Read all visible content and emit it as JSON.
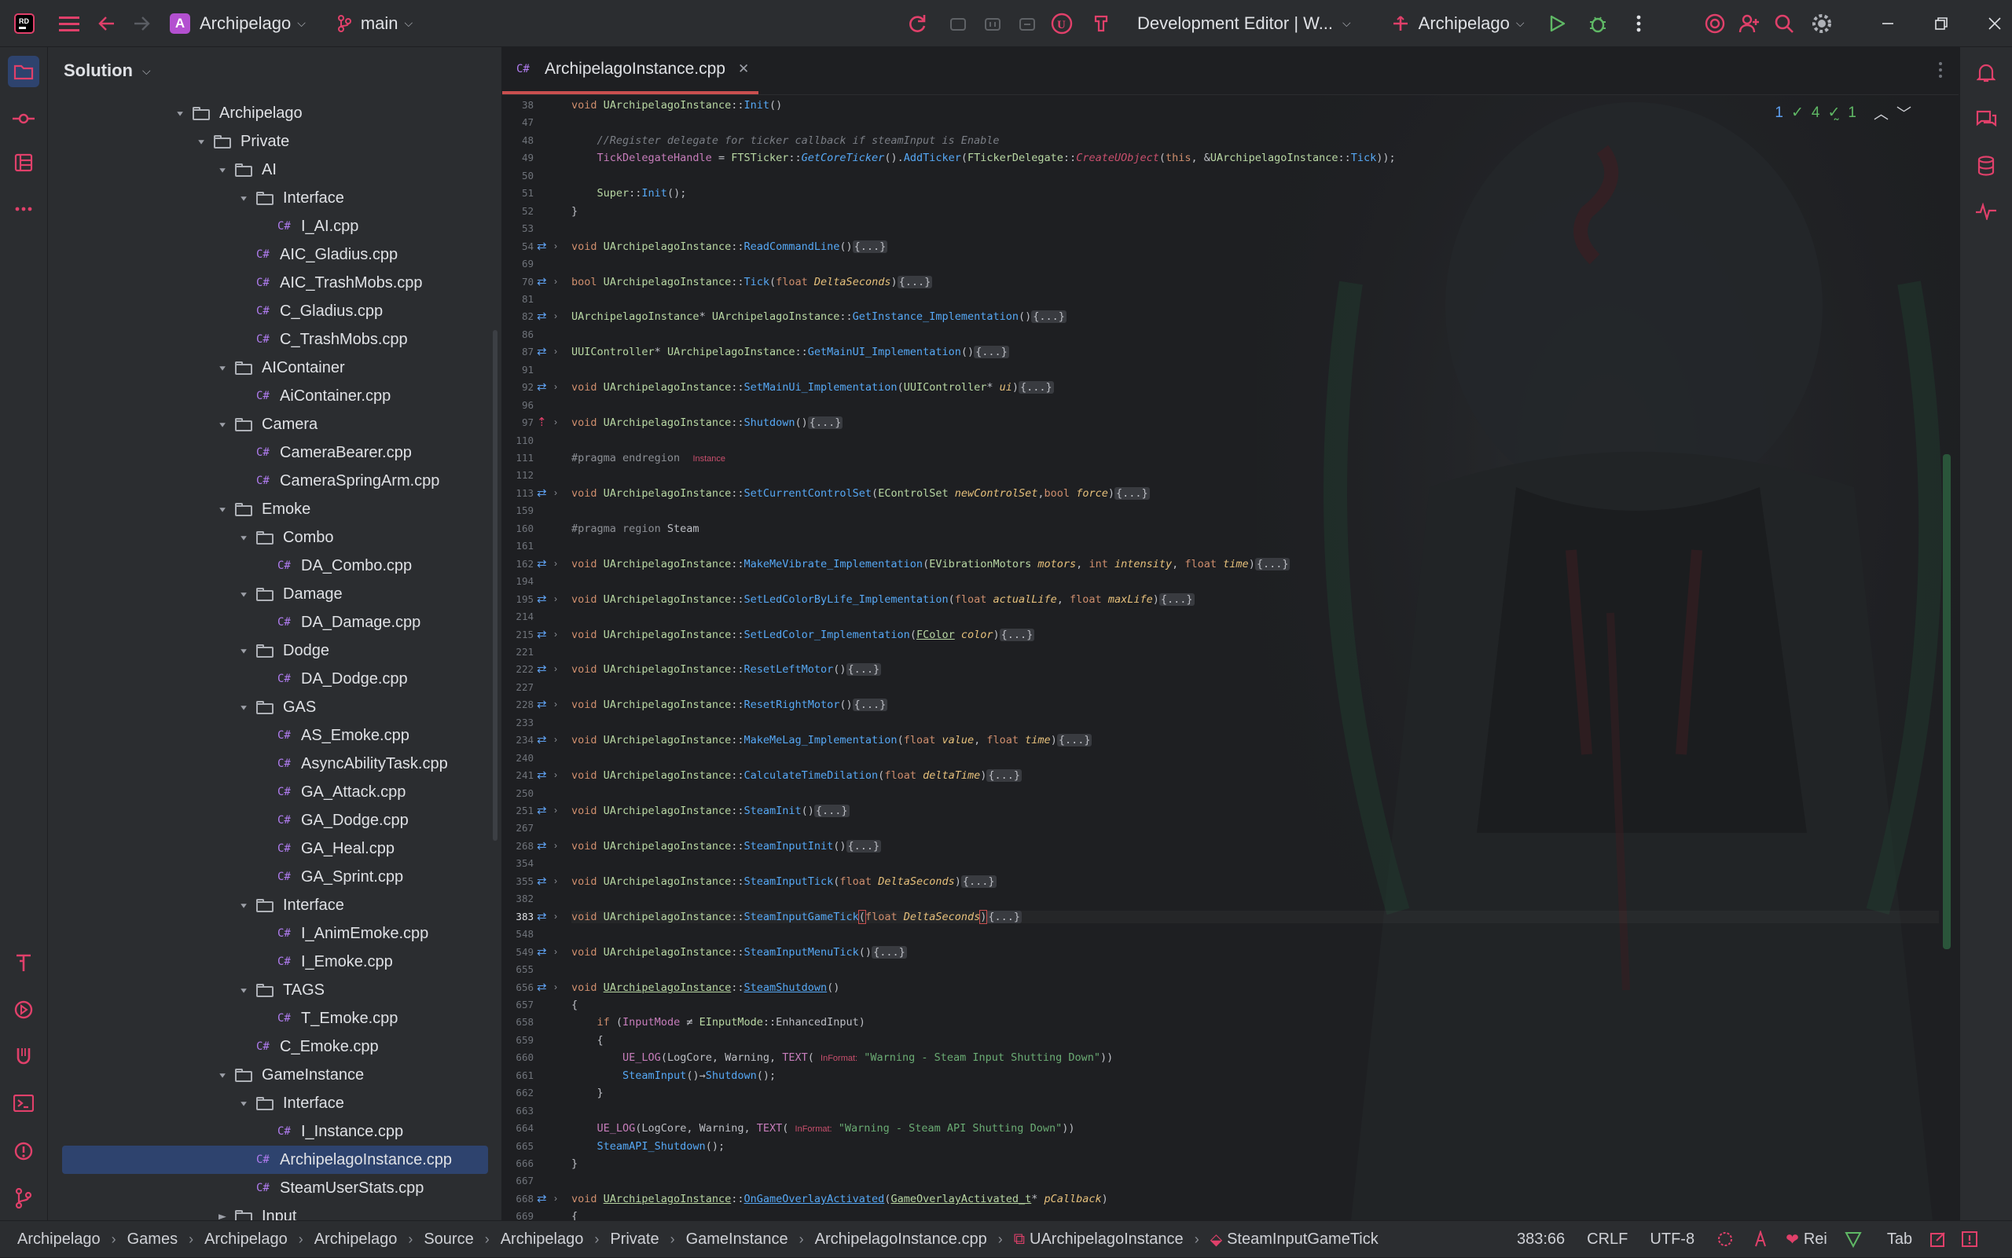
{
  "titlebar": {
    "project_initial": "A",
    "project_name": "Archipelago",
    "branch": "main",
    "config": "Development Editor | W...",
    "run_target": "Archipelago"
  },
  "panel": {
    "title": "Solution"
  },
  "tree": [
    {
      "label": "Archipelago",
      "type": "folder",
      "depth": 1,
      "expanded": true
    },
    {
      "label": "Private",
      "type": "folder",
      "depth": 2,
      "expanded": true
    },
    {
      "label": "AI",
      "type": "folder",
      "depth": 3,
      "expanded": true
    },
    {
      "label": "Interface",
      "type": "folder",
      "depth": 4,
      "expanded": true
    },
    {
      "label": "I_AI.cpp",
      "type": "file",
      "depth": 5
    },
    {
      "label": "AIC_Gladius.cpp",
      "type": "file",
      "depth": 4
    },
    {
      "label": "AIC_TrashMobs.cpp",
      "type": "file",
      "depth": 4
    },
    {
      "label": "C_Gladius.cpp",
      "type": "file",
      "depth": 4
    },
    {
      "label": "C_TrashMobs.cpp",
      "type": "file",
      "depth": 4
    },
    {
      "label": "AIContainer",
      "type": "folder",
      "depth": 3,
      "expanded": true
    },
    {
      "label": "AiContainer.cpp",
      "type": "file",
      "depth": 4
    },
    {
      "label": "Camera",
      "type": "folder",
      "depth": 3,
      "expanded": true
    },
    {
      "label": "CameraBearer.cpp",
      "type": "file",
      "depth": 4
    },
    {
      "label": "CameraSpringArm.cpp",
      "type": "file",
      "depth": 4
    },
    {
      "label": "Emoke",
      "type": "folder",
      "depth": 3,
      "expanded": true
    },
    {
      "label": "Combo",
      "type": "folder",
      "depth": 4,
      "expanded": true
    },
    {
      "label": "DA_Combo.cpp",
      "type": "file",
      "depth": 5
    },
    {
      "label": "Damage",
      "type": "folder",
      "depth": 4,
      "expanded": true
    },
    {
      "label": "DA_Damage.cpp",
      "type": "file",
      "depth": 5
    },
    {
      "label": "Dodge",
      "type": "folder",
      "depth": 4,
      "expanded": true
    },
    {
      "label": "DA_Dodge.cpp",
      "type": "file",
      "depth": 5
    },
    {
      "label": "GAS",
      "type": "folder",
      "depth": 4,
      "expanded": true
    },
    {
      "label": "AS_Emoke.cpp",
      "type": "file",
      "depth": 5
    },
    {
      "label": "AsyncAbilityTask.cpp",
      "type": "file",
      "depth": 5
    },
    {
      "label": "GA_Attack.cpp",
      "type": "file",
      "depth": 5
    },
    {
      "label": "GA_Dodge.cpp",
      "type": "file",
      "depth": 5
    },
    {
      "label": "GA_Heal.cpp",
      "type": "file",
      "depth": 5
    },
    {
      "label": "GA_Sprint.cpp",
      "type": "file",
      "depth": 5
    },
    {
      "label": "Interface",
      "type": "folder",
      "depth": 4,
      "expanded": true
    },
    {
      "label": "I_AnimEmoke.cpp",
      "type": "file",
      "depth": 5
    },
    {
      "label": "I_Emoke.cpp",
      "type": "file",
      "depth": 5
    },
    {
      "label": "TAGS",
      "type": "folder",
      "depth": 4,
      "expanded": true
    },
    {
      "label": "T_Emoke.cpp",
      "type": "file",
      "depth": 5
    },
    {
      "label": "C_Emoke.cpp",
      "type": "file",
      "depth": 4
    },
    {
      "label": "GameInstance",
      "type": "folder",
      "depth": 3,
      "expanded": true
    },
    {
      "label": "Interface",
      "type": "folder",
      "depth": 4,
      "expanded": true
    },
    {
      "label": "I_Instance.cpp",
      "type": "file",
      "depth": 5
    },
    {
      "label": "ArchipelagoInstance.cpp",
      "type": "file",
      "depth": 4,
      "selected": true
    },
    {
      "label": "SteamUserStats.cpp",
      "type": "file",
      "depth": 4
    },
    {
      "label": "Input",
      "type": "folder",
      "depth": 3,
      "expanded": false
    }
  ],
  "editor": {
    "tab_label": "ArchipelagoInstance.cpp",
    "inspections": {
      "info": "1",
      "ok": "4",
      "typo": "1"
    },
    "lines": [
      {
        "n": "38",
        "icon": "",
        "html": "<span class='k'>void</span> <span class='cls'>UArchipelagoInstance</span>::<span class='fn'>Init</span>()"
      },
      {
        "n": "47",
        "icon": "",
        "html": ""
      },
      {
        "n": "48",
        "icon": "",
        "html": "    <span class='cm'>//Register delegate for ticker callback if steamInput is Enable</span>"
      },
      {
        "n": "49",
        "icon": "",
        "html": "    <span class='m'>TickDelegateHandle</span> = <span class='cls'>FTSTicker</span>::<span class='fn' style='font-style:italic'>GetCoreTicker</span>().<span class='fn'>AddTicker</span>(<span class='cls'>FTickerDelegate</span>::<span class='fn' style='color:#c94f6d;font-style:italic'>CreateUObject</span>(<span class='k'>this</span>, &amp;<span class='cls'>UArchipelagoInstance</span>::<span class='fn'>Tick</span>));"
      },
      {
        "n": "50",
        "icon": "",
        "html": ""
      },
      {
        "n": "51",
        "icon": "",
        "html": "    <span class='cls'>Super</span>::<span class='fn'>Init</span>();"
      },
      {
        "n": "52",
        "icon": "",
        "html": "}"
      },
      {
        "n": "53",
        "icon": "",
        "html": ""
      },
      {
        "n": "54",
        "icon": "swap",
        "html": "<span class='k'>void</span> <span class='cls'>UArchipelagoInstance</span>::<span class='fn'>ReadCommandLine</span>()<span class='fold'>{...}</span>"
      },
      {
        "n": "69",
        "icon": "",
        "html": ""
      },
      {
        "n": "70",
        "icon": "swap",
        "html": "<span class='k'>bool</span> <span class='cls'>UArchipelagoInstance</span>::<span class='fn'>Tick</span>(<span class='k'>float</span> <span class='p'>DeltaSeconds</span>)<span class='fold'>{...}</span>"
      },
      {
        "n": "81",
        "icon": "",
        "html": ""
      },
      {
        "n": "82",
        "icon": "swap",
        "html": "<span class='cls'>UArchipelagoInstance</span>* <span class='cls'>UArchipelagoInstance</span>::<span class='fn'>GetInstance_Implementation</span>()<span class='fold'>{...}</span>"
      },
      {
        "n": "86",
        "icon": "",
        "html": ""
      },
      {
        "n": "87",
        "icon": "swap",
        "html": "<span class='cls'>UUIController</span>* <span class='cls'>UArchipelagoInstance</span>::<span class='fn'>GetMainUI_Implementation</span>()<span class='fold'>{...}</span>"
      },
      {
        "n": "91",
        "icon": "",
        "html": ""
      },
      {
        "n": "92",
        "icon": "swap",
        "html": "<span class='k'>void</span> <span class='cls'>UArchipelagoInstance</span>::<span class='fn'>SetMainUi_Implementation</span>(<span class='cls'>UUIController</span>* <span class='p'>ui</span>)<span class='fold'>{...}</span>"
      },
      {
        "n": "96",
        "icon": "",
        "html": ""
      },
      {
        "n": "97",
        "icon": "up",
        "html": "<span class='k'>void</span> <span class='cls'>UArchipelagoInstance</span>::<span class='fn'>Shutdown</span>()<span class='fold'>{...}</span>"
      },
      {
        "n": "110",
        "icon": "",
        "html": ""
      },
      {
        "n": "111",
        "icon": "",
        "html": "<span class='k' style='color:#8c8f95'>#pragma endregion</span>  <span class='hint'>Instance</span>"
      },
      {
        "n": "112",
        "icon": "",
        "html": ""
      },
      {
        "n": "113",
        "icon": "swap",
        "html": "<span class='k'>void</span> <span class='cls'>UArchipelagoInstance</span>::<span class='fn'>SetCurrentControlSet</span>(<span class='cls'>EControlSet</span> <span class='p'>newControlSet</span>,<span class='k'>bool</span> <span class='p'>force</span>)<span class='fold'>{...}</span>"
      },
      {
        "n": "159",
        "icon": "",
        "html": ""
      },
      {
        "n": "160",
        "icon": "",
        "html": "<span class='k' style='color:#8c8f95'>#pragma region</span> Steam"
      },
      {
        "n": "161",
        "icon": "",
        "html": ""
      },
      {
        "n": "162",
        "icon": "swap",
        "html": "<span class='k'>void</span> <span class='cls'>UArchipelagoInstance</span>::<span class='fn'>MakeMeVibrate_Implementation</span>(<span class='cls'>EVibrationMotors</span> <span class='p'>motors</span>, <span class='k'>int</span> <span class='p'>intensity</span>, <span class='k'>float</span> <span class='p'>time</span>)<span class='fold'>{...}</span>"
      },
      {
        "n": "194",
        "icon": "",
        "html": ""
      },
      {
        "n": "195",
        "icon": "swap",
        "html": "<span class='k'>void</span> <span class='cls'>UArchipelagoInstance</span>::<span class='fn'>SetLedColorByLife_Implementation</span>(<span class='k'>float</span> <span class='p'>actualLife</span>, <span class='k'>float</span> <span class='p'>maxLife</span>)<span class='fold'>{...}</span>"
      },
      {
        "n": "214",
        "icon": "",
        "html": ""
      },
      {
        "n": "215",
        "icon": "swap",
        "html": "<span class='k'>void</span> <span class='cls'>UArchipelagoInstance</span>::<span class='fn'>SetLedColor_Implementation</span>(<span class='cls' style='text-decoration:underline'>FColor</span> <span class='p'>color</span>)<span class='fold'>{...}</span>"
      },
      {
        "n": "221",
        "icon": "",
        "html": ""
      },
      {
        "n": "222",
        "icon": "swap",
        "html": "<span class='k'>void</span> <span class='cls'>UArchipelagoInstance</span>::<span class='fn'>ResetLeftMotor</span>()<span class='fold'>{...}</span>"
      },
      {
        "n": "227",
        "icon": "",
        "html": ""
      },
      {
        "n": "228",
        "icon": "swap",
        "html": "<span class='k'>void</span> <span class='cls'>UArchipelagoInstance</span>::<span class='fn'>ResetRightMotor</span>()<span class='fold'>{...}</span>"
      },
      {
        "n": "233",
        "icon": "",
        "html": ""
      },
      {
        "n": "234",
        "icon": "swap",
        "html": "<span class='k'>void</span> <span class='cls'>UArchipelagoInstance</span>::<span class='fn'>MakeMeLag_Implementation</span>(<span class='k'>float</span> <span class='p'>value</span>, <span class='k'>float</span> <span class='p'>time</span>)<span class='fold'>{...}</span>"
      },
      {
        "n": "240",
        "icon": "",
        "html": ""
      },
      {
        "n": "241",
        "icon": "swap",
        "html": "<span class='k'>void</span> <span class='cls'>UArchipelagoInstance</span>::<span class='fn'>CalculateTimeDilation</span>(<span class='k'>float</span> <span class='p'>deltaTime</span>)<span class='fold'>{...}</span>"
      },
      {
        "n": "250",
        "icon": "",
        "html": ""
      },
      {
        "n": "251",
        "icon": "swap",
        "html": "<span class='k'>void</span> <span class='cls'>UArchipelagoInstance</span>::<span class='fn'>SteamInit</span>()<span class='fold'>{...}</span>"
      },
      {
        "n": "267",
        "icon": "",
        "html": ""
      },
      {
        "n": "268",
        "icon": "swap",
        "html": "<span class='k'>void</span> <span class='cls'>UArchipelagoInstance</span>::<span class='fn'>SteamInputInit</span>()<span class='fold'>{...}</span>"
      },
      {
        "n": "354",
        "icon": "",
        "html": ""
      },
      {
        "n": "355",
        "icon": "swap",
        "html": "<span class='k'>void</span> <span class='cls'>UArchipelagoInstance</span>::<span class='fn'>SteamInputTick</span>(<span class='k'>float</span> <span class='p'>DeltaSeconds</span>)<span class='fold'>{...}</span>"
      },
      {
        "n": "382",
        "icon": "",
        "html": ""
      },
      {
        "n": "383",
        "icon": "swap",
        "cur": true,
        "html": "<span class='k'>void</span> <span class='cls'>UArchipelagoInstance</span>::<span class='fn'>SteamInputGameTick</span><span style='outline:1px solid #c94f4f'>(</span><span class='k'>float</span> <span class='p'>DeltaSeconds</span><span style='outline:1px solid #c94f4f'>)</span><span class='fold'>{...}</span>"
      },
      {
        "n": "548",
        "icon": "",
        "html": ""
      },
      {
        "n": "549",
        "icon": "swap",
        "html": "<span class='k'>void</span> <span class='cls'>UArchipelagoInstance</span>::<span class='fn'>SteamInputMenuTick</span>()<span class='fold'>{...}</span>"
      },
      {
        "n": "655",
        "icon": "",
        "html": ""
      },
      {
        "n": "656",
        "icon": "swap",
        "html": "<span class='k'>void</span> <span class='cls' style='text-decoration:underline'>UArchipelagoInstance</span>::<span class='fn' style='text-decoration:underline'>SteamShutdown</span>()"
      },
      {
        "n": "657",
        "icon": "",
        "html": "{"
      },
      {
        "n": "658",
        "icon": "",
        "html": "    <span class='k'>if</span> (<span class='m'>InputMode</span> ≠ <span class='cls'>EInputMode</span>::EnhancedInput)"
      },
      {
        "n": "659",
        "icon": "",
        "html": "    {"
      },
      {
        "n": "660",
        "icon": "",
        "html": "        <span class='m'>UE_LOG</span>(LogCore, Warning, <span class='m'>TEXT</span>( <span class='hint'>InFormat:</span> <span class='str'>\"Warning - Steam Input Shutting Down\"</span>))"
      },
      {
        "n": "661",
        "icon": "",
        "html": "        <span class='fn'>SteamInput</span>()→<span class='fn'>Shutdown</span>();"
      },
      {
        "n": "662",
        "icon": "",
        "html": "    }"
      },
      {
        "n": "663",
        "icon": "",
        "html": ""
      },
      {
        "n": "664",
        "icon": "",
        "html": "    <span class='m'>UE_LOG</span>(LogCore, Warning, <span class='m'>TEXT</span>( <span class='hint'>InFormat:</span> <span class='str'>\"Warning - Steam API Shutting Down\"</span>))"
      },
      {
        "n": "665",
        "icon": "",
        "html": "    <span class='fn'>SteamAPI_Shutdown</span>();"
      },
      {
        "n": "666",
        "icon": "",
        "html": "}"
      },
      {
        "n": "667",
        "icon": "",
        "html": ""
      },
      {
        "n": "668",
        "icon": "swap",
        "html": "<span class='k'>void</span> <span class='cls' style='text-decoration:underline'>UArchipelagoInstance</span>::<span class='fn' style='text-decoration:underline'>OnGameOverlayActivated</span>(<span class='cls' style='text-decoration:underline'>GameOverlayActivated_t</span>* <span class='p'>pCallback</span>)"
      },
      {
        "n": "669",
        "icon": "",
        "html": "{"
      }
    ]
  },
  "status": {
    "breadcrumbs": [
      "Archipelago",
      "Games",
      "Archipelago",
      "Archipelago",
      "Source",
      "Archipelago",
      "Private",
      "GameInstance",
      "ArchipelagoInstance.cpp",
      "UArchipelagoInstance",
      "SteamInputGameTick"
    ],
    "position": "383:66",
    "line_ending": "CRLF",
    "encoding": "UTF-8",
    "user": "Rei",
    "indent": "Tab"
  }
}
